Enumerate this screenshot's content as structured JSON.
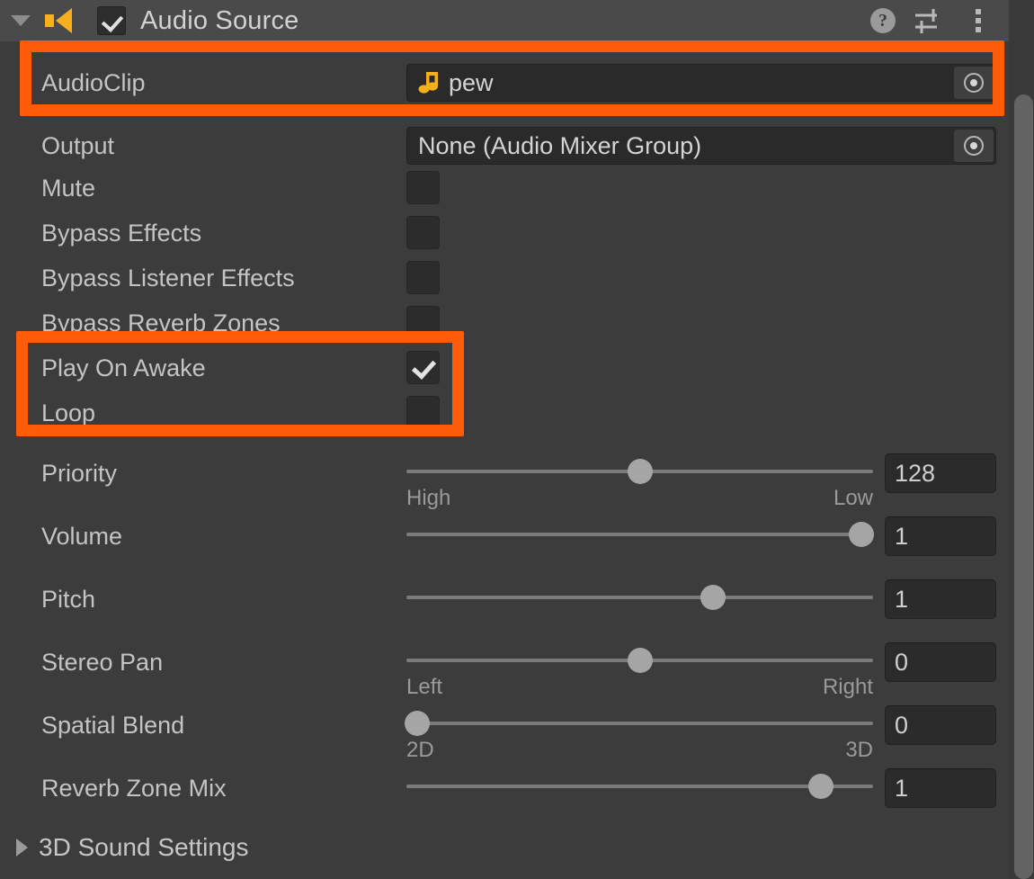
{
  "header": {
    "title": "Audio Source",
    "enabled_checkbox": true,
    "icons": {
      "foldout": "chevron-down-icon",
      "component": "speaker-icon",
      "help": "?",
      "preset": "preset-sliders-icon",
      "menu": "kebab-menu-icon"
    }
  },
  "colors": {
    "accent_highlight": "#ff5c0a",
    "panel_bg": "#3c3c3c",
    "header_bg": "#4a4a4a",
    "label_text": "#c4c4c4",
    "field_bg": "#2a2a2a",
    "slider_track": "#7b7b7b",
    "slider_knob": "#a5a5a5",
    "clip_icon": "#f6b01e"
  },
  "object_fields": [
    {
      "label": "AudioClip",
      "value": "pew",
      "icon": "music-note-icon",
      "has_icon": true,
      "picker": "object-picker-icon",
      "highlighted": true
    },
    {
      "label": "Output",
      "value": "None (Audio Mixer Group)",
      "icon": "",
      "has_icon": false,
      "picker": "object-picker-icon",
      "highlighted": false
    }
  ],
  "toggles": [
    {
      "label": "Mute",
      "checked": false,
      "highlighted": false
    },
    {
      "label": "Bypass Effects",
      "checked": false,
      "highlighted": false
    },
    {
      "label": "Bypass Listener Effects",
      "checked": false,
      "highlighted": false
    },
    {
      "label": "Bypass Reverb Zones",
      "checked": false,
      "highlighted": false
    },
    {
      "label": "Play On Awake",
      "checked": true,
      "highlighted": true
    },
    {
      "label": "Loop",
      "checked": false,
      "highlighted": true
    }
  ],
  "sliders": [
    {
      "label": "Priority",
      "value": "128",
      "fraction": 0.5,
      "left_label": "High",
      "right_label": "Low"
    },
    {
      "label": "Volume",
      "value": "1",
      "fraction": 0.975,
      "left_label": "",
      "right_label": ""
    },
    {
      "label": "Pitch",
      "value": "1",
      "fraction": 0.657,
      "left_label": "",
      "right_label": ""
    },
    {
      "label": "Stereo Pan",
      "value": "0",
      "fraction": 0.5,
      "left_label": "Left",
      "right_label": "Right"
    },
    {
      "label": "Spatial Blend",
      "value": "0",
      "fraction": 0.023,
      "left_label": "2D",
      "right_label": "3D"
    },
    {
      "label": "Reverb Zone Mix",
      "value": "1",
      "fraction": 0.888,
      "left_label": "",
      "right_label": ""
    }
  ],
  "foldouts": [
    {
      "label": "3D Sound Settings",
      "expanded": false,
      "icon": "chevron-right-icon"
    }
  ],
  "scrollbar": {
    "present": true
  }
}
